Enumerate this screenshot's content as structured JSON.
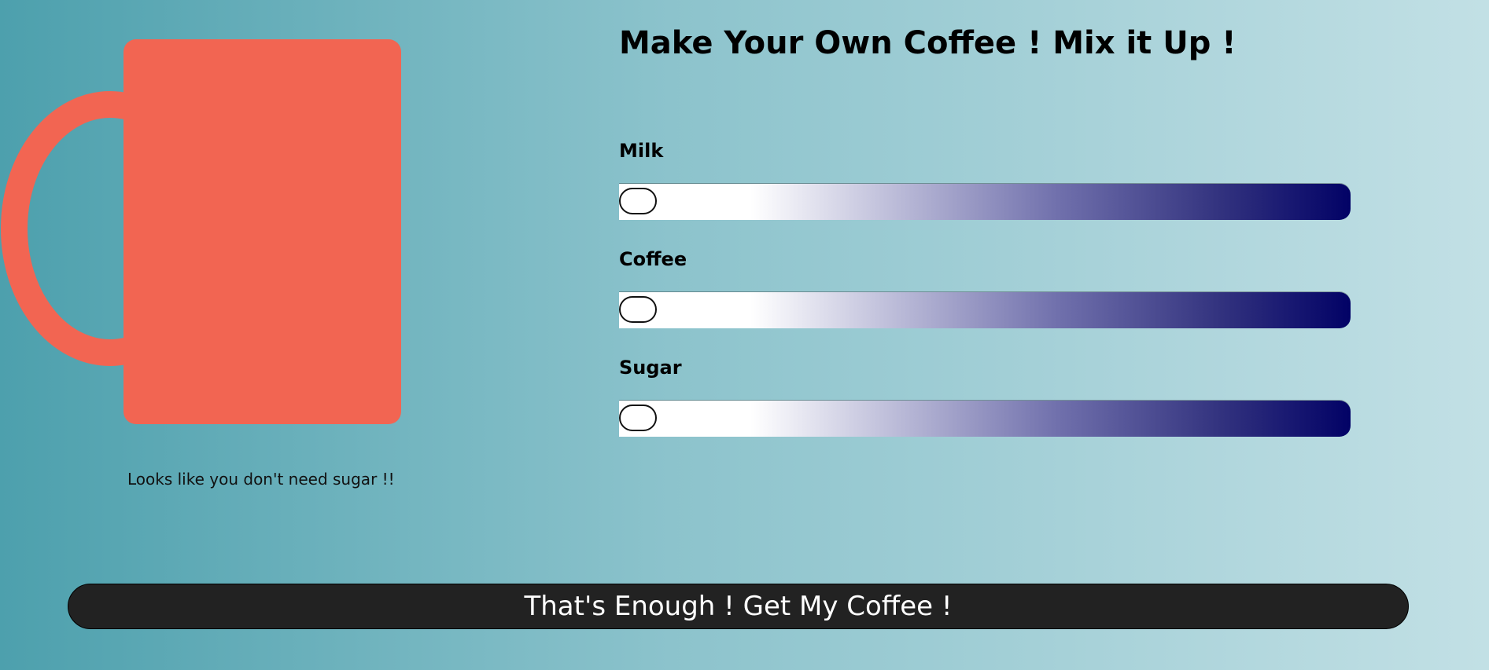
{
  "mug": {
    "icon": "mug-icon",
    "color": "#f26552",
    "caption": "Looks like you don't need sugar !!"
  },
  "header": {
    "title": "Make Your Own Coffee ! Mix it Up !"
  },
  "ingredients": [
    {
      "label": "Milk",
      "value": 0
    },
    {
      "label": "Coffee",
      "value": 0
    },
    {
      "label": "Sugar",
      "value": 0
    }
  ],
  "slider_colors": {
    "start": "#ffffff",
    "end": "#020266"
  },
  "actions": {
    "get_coffee_label": "That's Enough ! Get My Coffee !"
  }
}
